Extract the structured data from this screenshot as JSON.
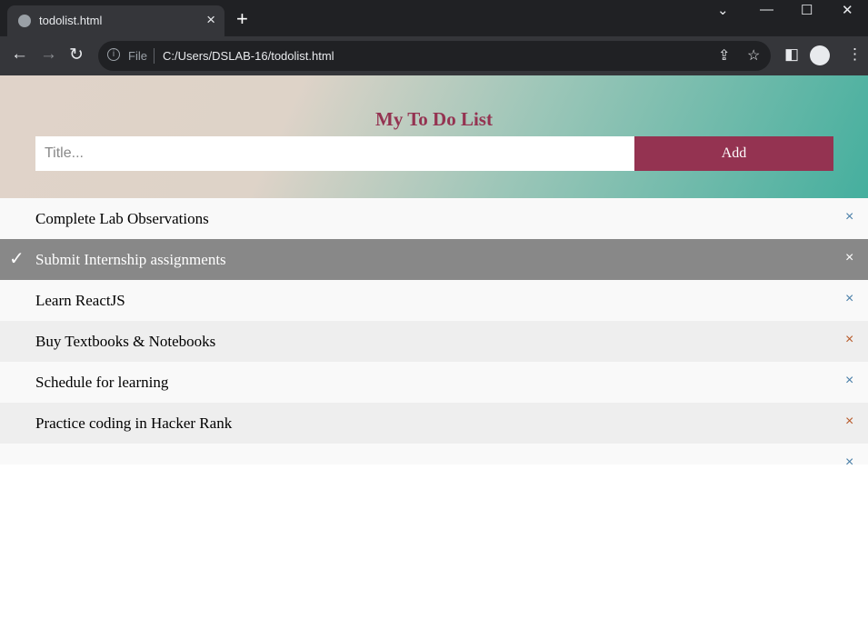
{
  "browser": {
    "tab_title": "todolist.html",
    "new_tab": "+",
    "file_label": "File",
    "url": "C:/Users/DSLAB-16/todolist.html"
  },
  "app": {
    "title": "My To Do List",
    "input_placeholder": "Title...",
    "add_label": "Add",
    "close_glyph": "×",
    "check_glyph": "✓"
  },
  "todos": [
    {
      "text": "Complete Lab Observations",
      "checked": false
    },
    {
      "text": "Submit Internship assignments",
      "checked": true
    },
    {
      "text": "Learn ReactJS",
      "checked": false
    },
    {
      "text": "Buy Textbooks & Notebooks",
      "checked": false
    },
    {
      "text": "Schedule for learning",
      "checked": false
    },
    {
      "text": "Practice coding in Hacker Rank",
      "checked": false
    },
    {
      "text": "",
      "checked": false
    }
  ]
}
